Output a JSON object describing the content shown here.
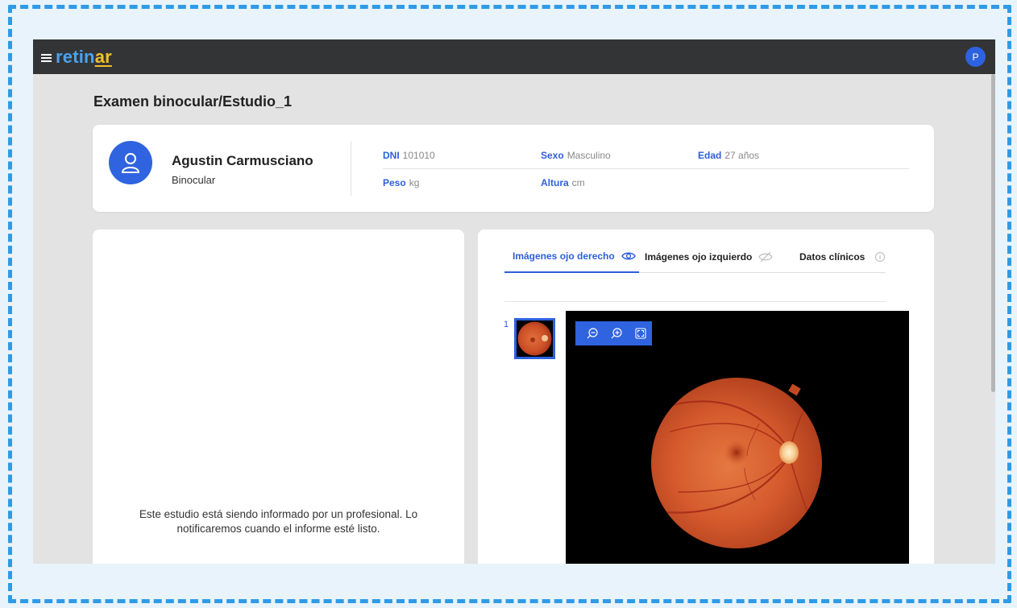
{
  "app": {
    "logo_main": "retin",
    "logo_accent": "ar",
    "user_initial": "P"
  },
  "page": {
    "title": "Examen binocular/Estudio_1"
  },
  "patient": {
    "name": "Agustin Carmusciano",
    "type": "Binocular",
    "fields": {
      "dni_label": "DNI",
      "dni_value": "101010",
      "sexo_label": "Sexo",
      "sexo_value": "Masculino",
      "edad_label": "Edad",
      "edad_value": "27 años",
      "peso_label": "Peso",
      "peso_value": "kg",
      "altura_label": "Altura",
      "altura_value": "cm"
    }
  },
  "report": {
    "message": "Este estudio está siendo informado por un profesional. Lo notificaremos cuando el informe esté listo."
  },
  "tabs": [
    {
      "label": "Imágenes ojo derecho",
      "icon": "eye-icon",
      "active": true
    },
    {
      "label": "Imágenes ojo izquierdo",
      "icon": "eye-off-icon",
      "active": false
    },
    {
      "label": "Datos clínicos",
      "icon": "info-icon",
      "active": false
    }
  ],
  "images": {
    "thumbnails": [
      {
        "index": "1"
      }
    ]
  },
  "colors": {
    "topbar": "#333435",
    "accent": "#2d5fdb",
    "logo_blue": "#4aa3ee",
    "logo_yellow": "#f2c02b",
    "frame": "#2f9be6"
  }
}
